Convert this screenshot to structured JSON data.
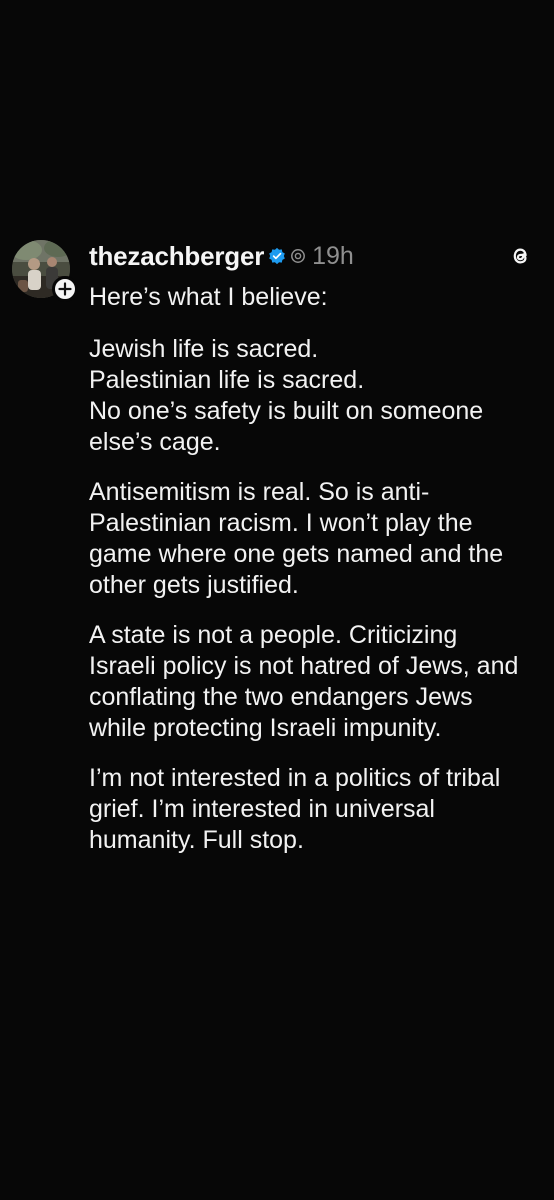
{
  "post": {
    "username": "thezachberger",
    "timestamp": "19h",
    "icons": {
      "verified": "verified-badge-icon",
      "threads_mini": "threads-mini-icon",
      "threads_logo": "threads-logo-icon",
      "follow": "plus-icon"
    },
    "colors": {
      "verified": "#1d9bf0",
      "background": "#070707",
      "muted": "#8f8f8f"
    },
    "paragraphs": [
      "Here’s what I believe:",
      "Jewish life is sacred.\nPalestinian life is sacred.\nNo one’s safety is built on someone else’s cage.",
      "Antisemitism is real. So is anti-Palestinian racism. I won’t play the game where one gets named and the other gets justified.",
      "A state is not a people. Criticizing Israeli policy is not hatred of Jews, and conflating the two endangers Jews while protecting Israeli impunity.",
      "I’m not interested in a politics of tribal grief. I’m interested in universal humanity. Full stop."
    ]
  }
}
